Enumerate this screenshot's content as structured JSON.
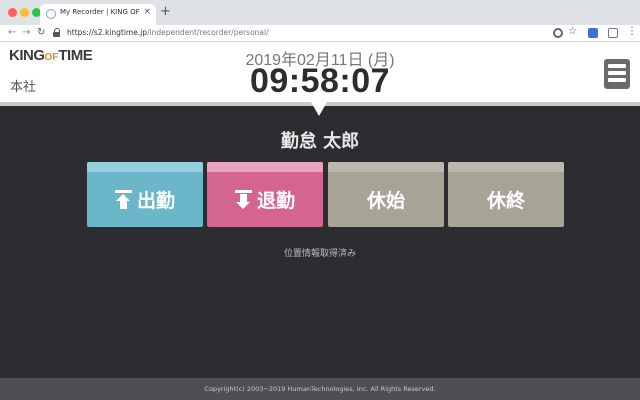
{
  "browser": {
    "tab_title": "My Recorder | KING OF TIME",
    "tab_close": "×",
    "new_tab": "+",
    "url_host": "https://s2.kingtime.jp",
    "url_path": "/independent/recorder/personal/",
    "icons": [
      "back-icon",
      "forward-icon",
      "reload-icon",
      "lock-icon",
      "location-icon",
      "star-icon",
      "extension-icon",
      "extension-icon",
      "menu-dots-icon"
    ]
  },
  "header": {
    "brand_left": "KING",
    "brand_of": "OF",
    "brand_right": "TIME",
    "office": "本社",
    "date": "2019年02月11日 (月)",
    "time": "09:58:07"
  },
  "main": {
    "user_name": "勤怠 太郎",
    "buttons": {
      "clock_in": "出勤",
      "clock_out": "退勤",
      "break_start": "休始",
      "break_end": "休終"
    },
    "location_status": "位置情報取得済み"
  },
  "footer": {
    "copyright": "Copyright(c) 2003−2019 HumanTechnologies, Inc. All Rights Reserved."
  },
  "colors": {
    "clock_in": "#6bb7c9",
    "clock_out": "#d4658e",
    "break": "#a8a397",
    "background": "#2c2d31"
  }
}
